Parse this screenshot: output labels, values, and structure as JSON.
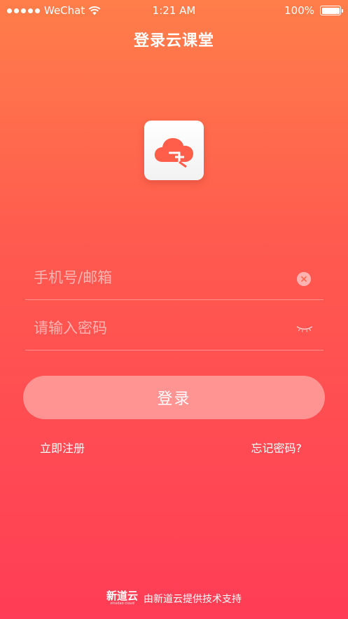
{
  "status_bar": {
    "carrier": "WeChat",
    "time": "1:21 AM",
    "battery": "100%"
  },
  "header": {
    "title": "登录云课堂"
  },
  "logo": {
    "icon": "cloud-icon",
    "colors": {
      "cloud": "#ff5e4a",
      "background": "#ffffff"
    }
  },
  "form": {
    "phone_placeholder": "手机号/邮箱",
    "phone_value": "",
    "password_placeholder": "请输入密码",
    "password_value": "",
    "clear_icon": "clear-icon",
    "visibility_icon": "eye-closed-icon"
  },
  "actions": {
    "login_label": "登录",
    "register_label": "立即注册",
    "forgot_label": "忘记密码?"
  },
  "footer": {
    "brand": "新道云",
    "brand_sub": "xinsdao cloud",
    "text": "由新道云提供技术支持"
  },
  "colors": {
    "gradient_top": "#ff7e4a",
    "gradient_bottom": "#ff3d56",
    "accent": "#ff5e4a"
  }
}
